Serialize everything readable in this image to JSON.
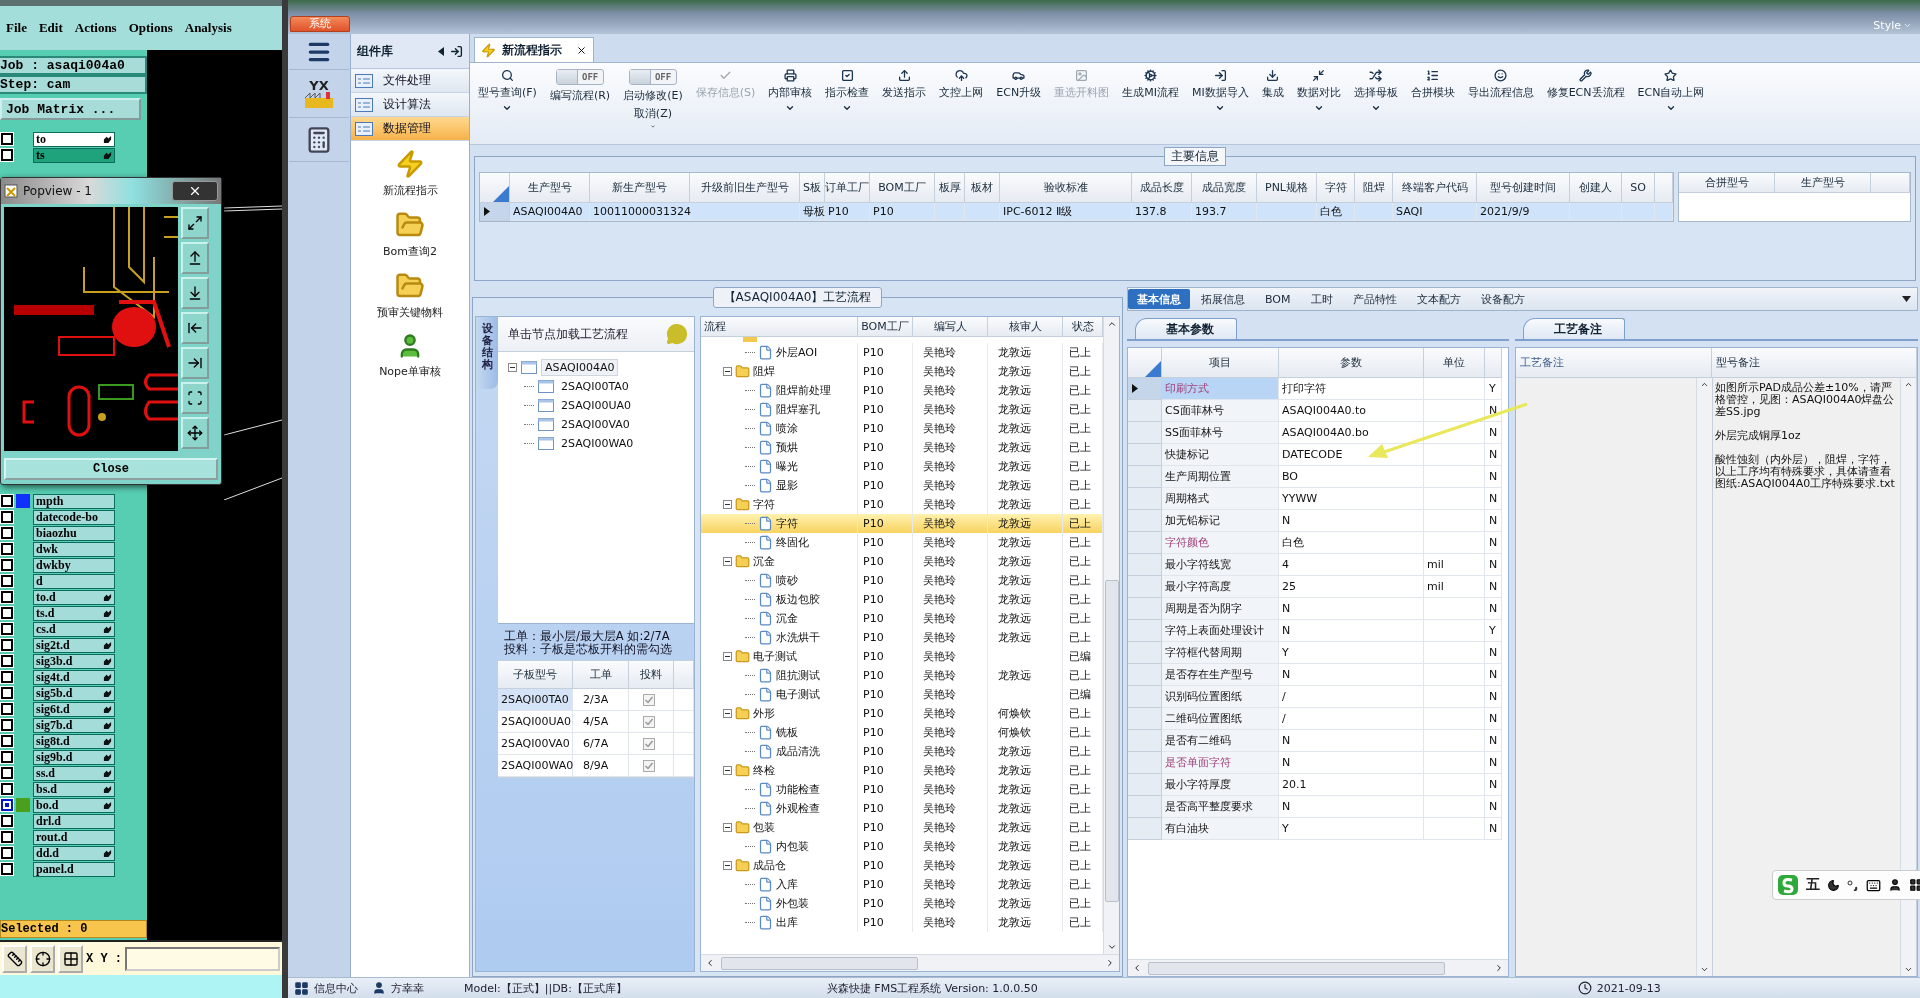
{
  "cam": {
    "menu": [
      "File",
      "Edit",
      "Actions",
      "Options",
      "Analysis"
    ],
    "job_label": "Job : asaqi004a0",
    "step_label": "Step: cam",
    "matrix_button": "Job Matrix ...",
    "layers_top": [
      {
        "name": "to",
        "kind": "work",
        "marked": true,
        "active": false
      },
      {
        "name": "ts",
        "kind": "displayed",
        "marked": true,
        "active": false
      }
    ],
    "layers": [
      {
        "name": "mpth",
        "kind": "plain",
        "color": "#1030ff",
        "marked": false,
        "active": false
      },
      {
        "name": "datecode-bo",
        "kind": "plain",
        "marked": false,
        "active": false
      },
      {
        "name": "biaozhu",
        "kind": "plain",
        "marked": false,
        "active": false
      },
      {
        "name": "dwk",
        "kind": "plain",
        "marked": false,
        "active": false
      },
      {
        "name": "dwkby",
        "kind": "plain",
        "marked": false,
        "active": false
      },
      {
        "name": "d",
        "kind": "plain",
        "marked": false,
        "active": false
      },
      {
        "name": "to.d",
        "kind": "plain",
        "marked": true,
        "active": false
      },
      {
        "name": "ts.d",
        "kind": "plain",
        "marked": true,
        "active": false
      },
      {
        "name": "cs.d",
        "kind": "plain",
        "marked": true,
        "active": false
      },
      {
        "name": "sig2t.d",
        "kind": "plain",
        "marked": true,
        "active": false
      },
      {
        "name": "sig3b.d",
        "kind": "plain",
        "marked": true,
        "active": false
      },
      {
        "name": "sig4t.d",
        "kind": "plain",
        "marked": true,
        "active": false
      },
      {
        "name": "sig5b.d",
        "kind": "plain",
        "marked": true,
        "active": false
      },
      {
        "name": "sig6t.d",
        "kind": "plain",
        "marked": true,
        "active": false
      },
      {
        "name": "sig7b.d",
        "kind": "plain",
        "marked": true,
        "active": false
      },
      {
        "name": "sig8t.d",
        "kind": "plain",
        "marked": true,
        "active": false
      },
      {
        "name": "sig9b.d",
        "kind": "plain",
        "marked": true,
        "active": false
      },
      {
        "name": "ss.d",
        "kind": "plain",
        "marked": true,
        "active": false
      },
      {
        "name": "bs.d",
        "kind": "plain",
        "marked": true,
        "active": false
      },
      {
        "name": "bo.d",
        "kind": "plain",
        "color": "#4aa01c",
        "marked": true,
        "active": true
      },
      {
        "name": "drl.d",
        "kind": "plain",
        "marked": false,
        "active": false
      },
      {
        "name": "rout.d",
        "kind": "plain",
        "marked": false,
        "active": false
      },
      {
        "name": "dd.d",
        "kind": "plain",
        "marked": true,
        "active": false
      },
      {
        "name": "panel.d",
        "kind": "plain",
        "marked": false,
        "active": false
      }
    ],
    "selected_count": "Selected : 0",
    "xy_label": "X Y :",
    "popview": {
      "title": "Popview - 1",
      "close_button": "Close"
    }
  },
  "top": {
    "system_tab": "系统",
    "style_menu": "Style"
  },
  "nav": {
    "logo_text": "YX"
  },
  "library": {
    "title": "组件库",
    "categories": [
      {
        "label": "文件处理",
        "selected": false
      },
      {
        "label": "设计算法",
        "selected": false
      },
      {
        "label": "数据管理",
        "selected": true
      }
    ],
    "tools": [
      "新流程指示",
      "Bom查询2",
      "预审关键物料",
      "Nope单审核"
    ]
  },
  "doc_tab": {
    "label": "新流程指示"
  },
  "toolbar": [
    {
      "kind": "button",
      "label": "型号查询(F)",
      "disabled": false,
      "dropdown": true
    },
    {
      "kind": "toggle",
      "label": "编写流程(R)",
      "switch_text": "OFF",
      "on": false,
      "dropdown": false
    },
    {
      "kind": "toggle",
      "label": "启动修改(E)",
      "sub_label": "取消(Z)",
      "switch_text": "OFF",
      "on": false,
      "dropdown": true
    },
    {
      "kind": "button",
      "label": "保存信息(S)",
      "disabled": true,
      "dropdown": false
    },
    {
      "kind": "button",
      "label": "内部审核",
      "disabled": false,
      "dropdown": true
    },
    {
      "kind": "button",
      "label": "指示检查",
      "disabled": false,
      "dropdown": true
    },
    {
      "kind": "button",
      "label": "发送指示",
      "disabled": false,
      "dropdown": false
    },
    {
      "kind": "button",
      "label": "文控上网",
      "disabled": false,
      "dropdown": false
    },
    {
      "kind": "button",
      "label": "ECN升级",
      "disabled": false,
      "dropdown": false
    },
    {
      "kind": "button",
      "label": "重选开料图",
      "disabled": true,
      "dropdown": false
    },
    {
      "kind": "button",
      "label": "生成MI流程",
      "disabled": false,
      "dropdown": false
    },
    {
      "kind": "button",
      "label": "MI数据导入",
      "disabled": false,
      "dropdown": true
    },
    {
      "kind": "button",
      "label": "集成",
      "disabled": false,
      "dropdown": false
    },
    {
      "kind": "button",
      "label": "数据对比",
      "disabled": false,
      "dropdown": true
    },
    {
      "kind": "button",
      "label": "选择母板",
      "disabled": false,
      "dropdown": true
    },
    {
      "kind": "button",
      "label": "合拼模块",
      "disabled": false,
      "dropdown": false
    },
    {
      "kind": "button",
      "label": "导出流程信息",
      "disabled": false,
      "dropdown": false
    },
    {
      "kind": "button",
      "label": "修复ECN丢流程",
      "disabled": false,
      "dropdown": false
    },
    {
      "kind": "button",
      "label": "ECN自动上网",
      "disabled": false,
      "dropdown": true
    }
  ],
  "main_info": {
    "title": "主要信息",
    "columns": [
      "生产型号",
      "新生产型号",
      "升级前旧生产型号",
      "S板",
      "订单工厂",
      "BOM工厂",
      "板厚",
      "板材",
      "验收标准",
      "成品长度",
      "成品宽度",
      "PNL规格",
      "字符",
      "阻焊",
      "终端客户代码",
      "型号创建时间",
      "创建人",
      "SO"
    ],
    "rows": [
      {
        "selected": true,
        "cells": [
          "ASAQI004A0",
          "10011000031324",
          "",
          "母板",
          "P10",
          "P10",
          "",
          "",
          "IPC-6012 Ⅱ级",
          "137.8",
          "193.7",
          "",
          "白色",
          "",
          "SAQI",
          "2021/9/9",
          "",
          ""
        ]
      }
    ],
    "merge_columns": [
      "合拼型号",
      "生产型号"
    ]
  },
  "process": {
    "title": "【ASAQI004A0】工艺流程",
    "side_tab": "设备结构",
    "hint": "单击节点加载工艺流程",
    "tree": {
      "label": "ASAQI004A0",
      "expanded": true,
      "children": [
        {
          "label": "2SAQI00TA0"
        },
        {
          "label": "2SAQI00UA0"
        },
        {
          "label": "2SAQI00VA0"
        },
        {
          "label": "2SAQI00WA0"
        }
      ]
    },
    "note_lines": [
      "工单：最小层/最大层A 如:2/7A",
      "投料：子板是芯板开料的需勾选"
    ],
    "sub_columns": [
      "子板型号",
      "工单",
      "投料"
    ],
    "sub_rows": [
      {
        "board": "2SAQI00TA0",
        "order": "2/3A",
        "checked": true,
        "selected": true
      },
      {
        "board": "2SAQI00UA0",
        "order": "4/5A",
        "checked": true,
        "selected": false
      },
      {
        "board": "2SAQI00VA0",
        "order": "6/7A",
        "checked": true,
        "selected": false
      },
      {
        "board": "2SAQI00WA0",
        "order": "8/9A",
        "checked": true,
        "selected": false
      }
    ],
    "columns": [
      "流程",
      "BOM工厂",
      "编写人",
      "核审人",
      "状态"
    ],
    "groups": [
      {
        "children": [
          {
            "label": "外层AOI",
            "bom": "P10",
            "writer": "吴艳玲",
            "reviewer": "龙敦远",
            "status": "已上",
            "selected": false
          }
        ]
      },
      {
        "label": "阻焊",
        "expanded": true,
        "bom": "P10",
        "writer": "吴艳玲",
        "reviewer": "龙敦远",
        "status": "已上",
        "selected": false,
        "children": [
          {
            "label": "阻焊前处理",
            "bom": "P10",
            "writer": "吴艳玲",
            "reviewer": "龙敦远",
            "status": "已上",
            "selected": false
          },
          {
            "label": "阻焊塞孔",
            "bom": "P10",
            "writer": "吴艳玲",
            "reviewer": "龙敦远",
            "status": "已上",
            "selected": false
          },
          {
            "label": "喷涂",
            "bom": "P10",
            "writer": "吴艳玲",
            "reviewer": "龙敦远",
            "status": "已上",
            "selected": false
          },
          {
            "label": "预烘",
            "bom": "P10",
            "writer": "吴艳玲",
            "reviewer": "龙敦远",
            "status": "已上",
            "selected": false
          },
          {
            "label": "曝光",
            "bom": "P10",
            "writer": "吴艳玲",
            "reviewer": "龙敦远",
            "status": "已上",
            "selected": false
          },
          {
            "label": "显影",
            "bom": "P10",
            "writer": "吴艳玲",
            "reviewer": "龙敦远",
            "status": "已上",
            "selected": false
          }
        ]
      },
      {
        "label": "字符",
        "expanded": true,
        "bom": "P10",
        "writer": "吴艳玲",
        "reviewer": "龙敦远",
        "status": "已上",
        "selected": false,
        "children": [
          {
            "label": "字符",
            "bom": "P10",
            "writer": "吴艳玲",
            "reviewer": "龙敦远",
            "status": "已上",
            "selected": true
          },
          {
            "label": "终固化",
            "bom": "P10",
            "writer": "吴艳玲",
            "reviewer": "龙敦远",
            "status": "已上",
            "selected": false
          }
        ]
      },
      {
        "label": "沉金",
        "expanded": true,
        "bom": "P10",
        "writer": "吴艳玲",
        "reviewer": "龙敦远",
        "status": "已上",
        "selected": false,
        "children": [
          {
            "label": "喷砂",
            "bom": "P10",
            "writer": "吴艳玲",
            "reviewer": "龙敦远",
            "status": "已上",
            "selected": false
          },
          {
            "label": "板边包胶",
            "bom": "P10",
            "writer": "吴艳玲",
            "reviewer": "龙敦远",
            "status": "已上",
            "selected": false
          },
          {
            "label": "沉金",
            "bom": "P10",
            "writer": "吴艳玲",
            "reviewer": "龙敦远",
            "status": "已上",
            "selected": false
          },
          {
            "label": "水洗烘干",
            "bom": "P10",
            "writer": "吴艳玲",
            "reviewer": "龙敦远",
            "status": "已上",
            "selected": false
          }
        ]
      },
      {
        "label": "电子测试",
        "expanded": true,
        "bom": "P10",
        "writer": "吴艳玲",
        "status": "已编",
        "selected": false,
        "children": [
          {
            "label": "阻抗测试",
            "bom": "P10",
            "writer": "吴艳玲",
            "reviewer": "龙敦远",
            "status": "已上",
            "selected": false
          },
          {
            "label": "电子测试",
            "bom": "P10",
            "writer": "吴艳玲",
            "status": "已编",
            "selected": false
          }
        ]
      },
      {
        "label": "外形",
        "expanded": true,
        "bom": "P10",
        "writer": "吴艳玲",
        "reviewer": "何焕钦",
        "status": "已上",
        "selected": false,
        "children": [
          {
            "label": "铣板",
            "bom": "P10",
            "writer": "吴艳玲",
            "reviewer": "何焕钦",
            "status": "已上",
            "selected": false
          },
          {
            "label": "成品清洗",
            "bom": "P10",
            "writer": "吴艳玲",
            "reviewer": "龙敦远",
            "status": "已上",
            "selected": false
          }
        ]
      },
      {
        "label": "终检",
        "expanded": true,
        "bom": "P10",
        "writer": "吴艳玲",
        "reviewer": "龙敦远",
        "status": "已上",
        "selected": false,
        "children": [
          {
            "label": "功能检查",
            "bom": "P10",
            "writer": "吴艳玲",
            "reviewer": "龙敦远",
            "status": "已上",
            "selected": false
          },
          {
            "label": "外观检查",
            "bom": "P10",
            "writer": "吴艳玲",
            "reviewer": "龙敦远",
            "status": "已上",
            "selected": false
          }
        ]
      },
      {
        "label": "包装",
        "expanded": true,
        "bom": "P10",
        "writer": "吴艳玲",
        "reviewer": "龙敦远",
        "status": "已上",
        "selected": false,
        "children": [
          {
            "label": "内包装",
            "bom": "P10",
            "writer": "吴艳玲",
            "reviewer": "龙敦远",
            "status": "已上",
            "selected": false
          }
        ]
      },
      {
        "label": "成品仓",
        "expanded": true,
        "bom": "P10",
        "writer": "吴艳玲",
        "reviewer": "龙敦远",
        "status": "已上",
        "selected": false,
        "children": [
          {
            "label": "入库",
            "bom": "P10",
            "writer": "吴艳玲",
            "reviewer": "龙敦远",
            "status": "已上",
            "selected": false
          },
          {
            "label": "外包装",
            "bom": "P10",
            "writer": "吴艳玲",
            "reviewer": "龙敦远",
            "status": "已上",
            "selected": false
          },
          {
            "label": "出库",
            "bom": "P10",
            "writer": "吴艳玲",
            "reviewer": "龙敦远",
            "status": "已上",
            "selected": false
          }
        ]
      }
    ]
  },
  "detail_tabs": [
    {
      "label": "基本信息",
      "selected": true
    },
    {
      "label": "拓展信息",
      "selected": false
    },
    {
      "label": "BOM",
      "selected": false
    },
    {
      "label": "工时",
      "selected": false
    },
    {
      "label": "产品特性",
      "selected": false
    },
    {
      "label": "文本配方",
      "selected": false
    },
    {
      "label": "设备配方",
      "selected": false
    }
  ],
  "params": {
    "tab": "基本参数",
    "columns": [
      "项目",
      "参数",
      "单位"
    ],
    "rows": [
      {
        "item": "印刷方式",
        "value": "打印字符",
        "unit": "",
        "flag": "Y",
        "emphasized": true,
        "selected": true
      },
      {
        "item": "CS面菲林号",
        "value": "ASAQI004A0.to",
        "unit": "",
        "flag": "N",
        "emphasized": false,
        "selected": false
      },
      {
        "item": "SS面菲林号",
        "value": "ASAQI004A0.bo",
        "unit": "",
        "flag": "N",
        "emphasized": false,
        "selected": false
      },
      {
        "item": "快捷标记",
        "value": "DATECODE",
        "unit": "",
        "flag": "N",
        "emphasized": false,
        "selected": false
      },
      {
        "item": "生产周期位置",
        "value": "BO",
        "unit": "",
        "flag": "N",
        "emphasized": false,
        "selected": false
      },
      {
        "item": "周期格式",
        "value": "YYWW",
        "unit": "",
        "flag": "N",
        "emphasized": false,
        "selected": false
      },
      {
        "item": "加无铅标记",
        "value": "N",
        "unit": "",
        "flag": "N",
        "emphasized": false,
        "selected": false
      },
      {
        "item": "字符颜色",
        "value": "白色",
        "unit": "",
        "flag": "N",
        "emphasized": true,
        "selected": false
      },
      {
        "item": "最小字符线宽",
        "value": "4",
        "unit": "mil",
        "flag": "N",
        "emphasized": false,
        "selected": false
      },
      {
        "item": "最小字符高度",
        "value": "25",
        "unit": "mil",
        "flag": "N",
        "emphasized": false,
        "selected": false
      },
      {
        "item": "周期是否为阴字",
        "value": "N",
        "unit": "",
        "flag": "N",
        "emphasized": false,
        "selected": false
      },
      {
        "item": "字符上表面处理设计",
        "value": "N",
        "unit": "",
        "flag": "Y",
        "emphasized": false,
        "selected": false
      },
      {
        "item": "字符框代替周期",
        "value": "Y",
        "unit": "",
        "flag": "N",
        "emphasized": false,
        "selected": false
      },
      {
        "item": "是否存在生产型号",
        "value": "N",
        "unit": "",
        "flag": "N",
        "emphasized": false,
        "selected": false
      },
      {
        "item": "识别码位置图纸",
        "value": "/",
        "unit": "",
        "flag": "N",
        "emphasized": false,
        "selected": false
      },
      {
        "item": "二维码位置图纸",
        "value": "/",
        "unit": "",
        "flag": "N",
        "emphasized": false,
        "selected": false
      },
      {
        "item": "是否有二维码",
        "value": "N",
        "unit": "",
        "flag": "N",
        "emphasized": false,
        "selected": false
      },
      {
        "item": "是否单面字符",
        "value": "N",
        "unit": "",
        "flag": "N",
        "emphasized": true,
        "selected": false
      },
      {
        "item": "最小字符厚度",
        "value": "20.1",
        "unit": "",
        "flag": "N",
        "emphasized": false,
        "selected": false
      },
      {
        "item": "是否高平整度要求",
        "value": "N",
        "unit": "",
        "flag": "N",
        "emphasized": false,
        "selected": false
      },
      {
        "item": "有白油块",
        "value": "Y",
        "unit": "",
        "flag": "N",
        "emphasized": false,
        "selected": false
      }
    ]
  },
  "notes": {
    "tab": "工艺备注",
    "columns": [
      "工艺备注",
      "型号备注"
    ],
    "model_notes": [
      "如图所示PAD成品公差±10%，请严格管控，见图：ASAQI004A0焊盘公差SS.jpg",
      "外层完成铜厚1oz",
      "酸性蚀刻（内外层），阻焊，字符，以上工序均有特殊要求，具体请查看图纸:ASAQI004A0工序特殊要求.txt"
    ]
  },
  "ime": {
    "mode": "五"
  },
  "status_bar": {
    "info_center": "信息中心",
    "user": "方幸幸",
    "model": "Model:【正式】||DB:【正式库】",
    "app": "兴森快捷 FMS工程系统 Version: 1.0.0.50",
    "date": "2021-09-13"
  }
}
